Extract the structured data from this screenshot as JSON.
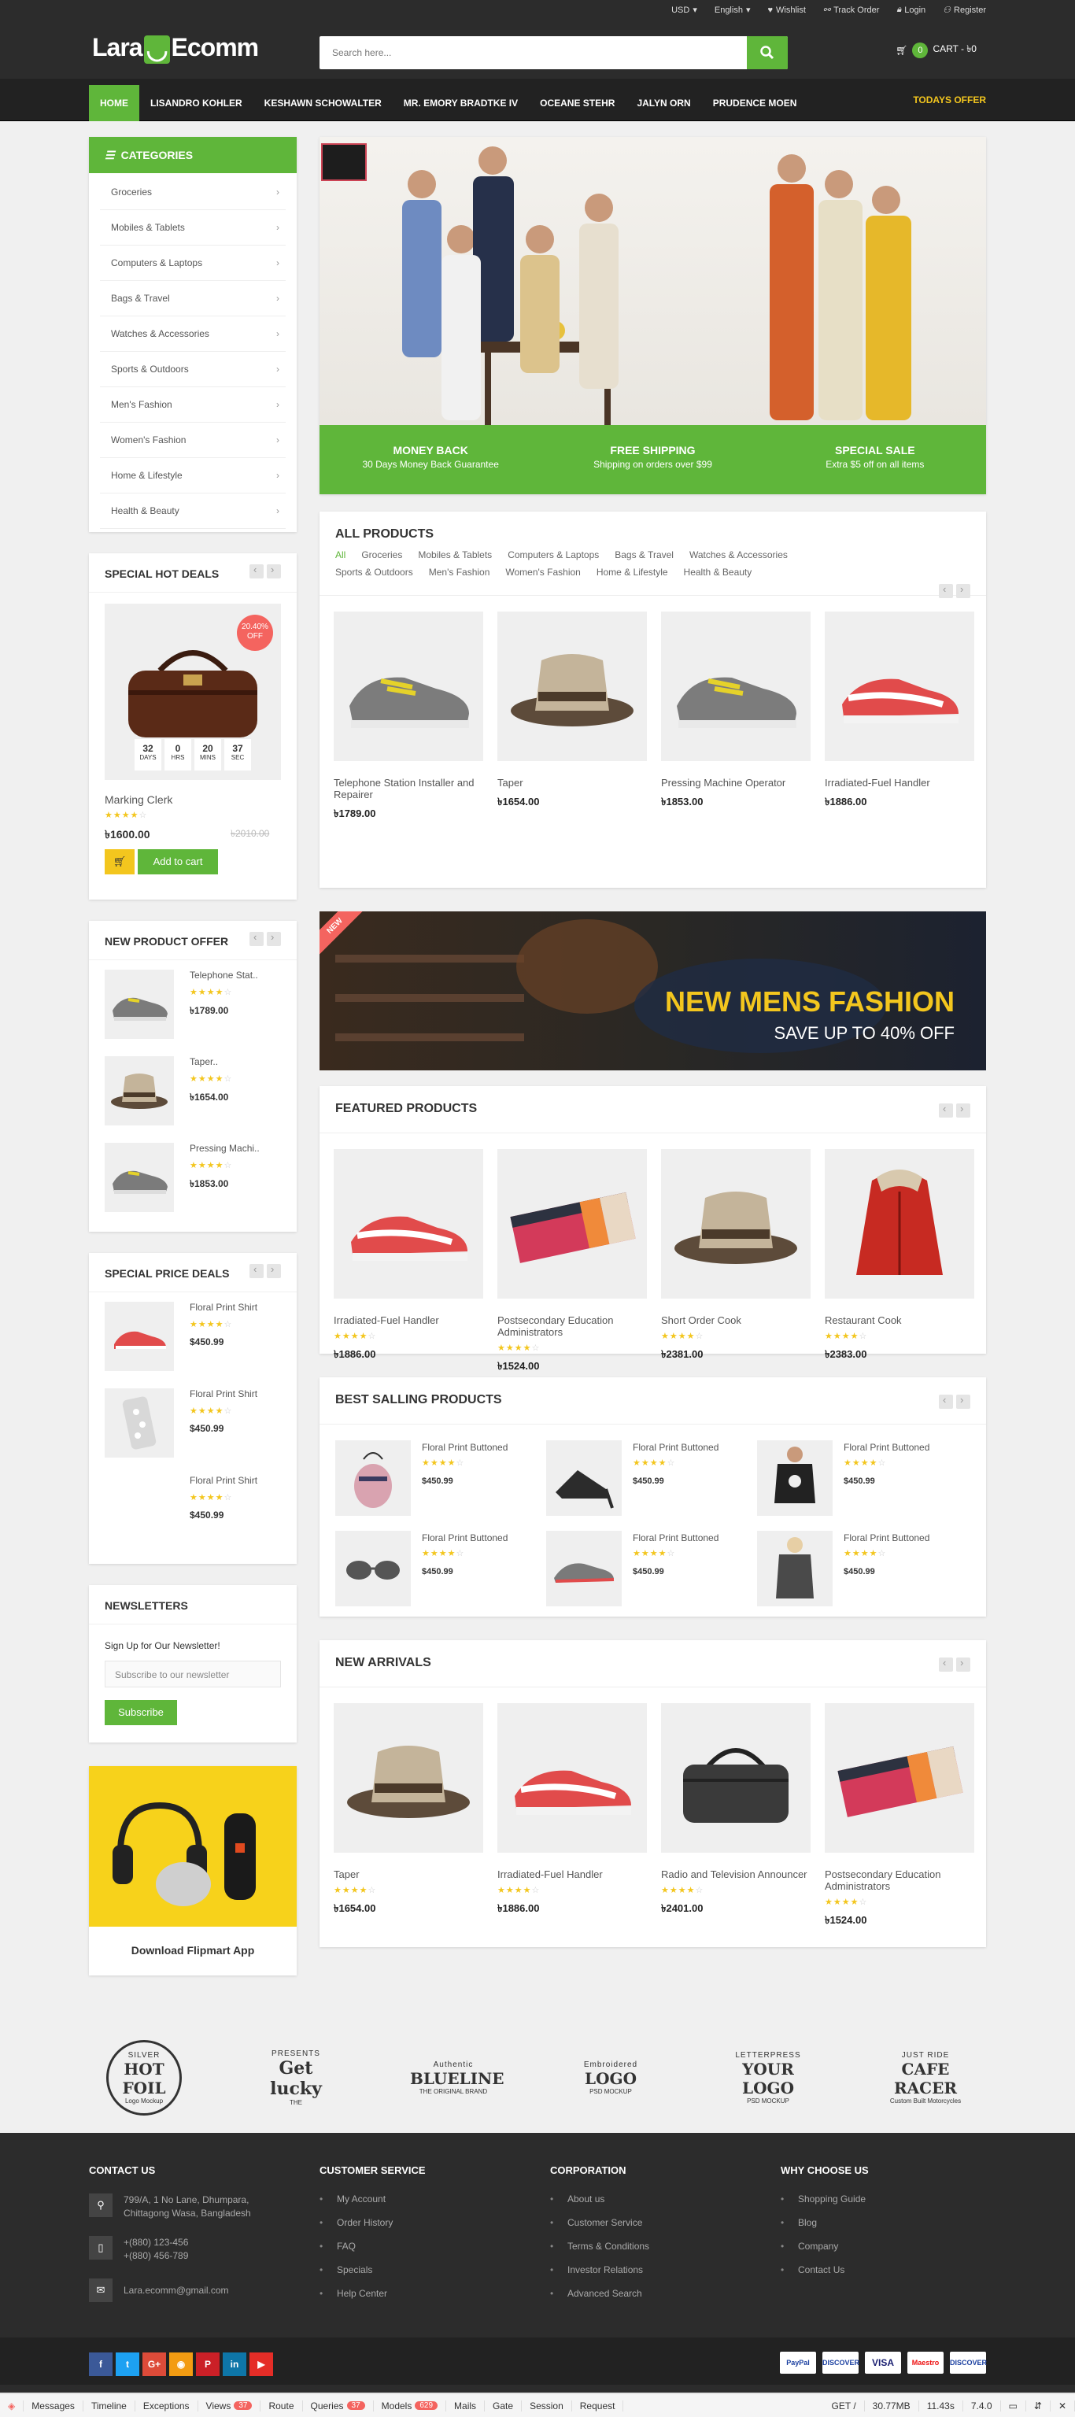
{
  "topbar": {
    "currency": "USD",
    "language": "English",
    "wishlist": "Wishlist",
    "track_order": "Track Order",
    "login": "Login",
    "register": "Register"
  },
  "logo": {
    "part1": "Lara",
    "part2": "Ecomm"
  },
  "search": {
    "placeholder": "Search here..."
  },
  "cart": {
    "count": "0",
    "label": "CART - ৳0"
  },
  "nav": {
    "items": [
      "Home",
      "Lisandro Kohler",
      "Keshawn Schowalter",
      "Mr. Emory Bradtke IV",
      "Oceane Stehr",
      "Jalyn Orn",
      "Prudence Moen"
    ],
    "offer": "Todays Offer"
  },
  "categories": {
    "title": "CATEGORIES",
    "items": [
      "Groceries",
      "Mobiles & Tablets",
      "Computers & Laptops",
      "Bags & Travel",
      "Watches & Accessories",
      "Sports & Outdoors",
      "Men's Fashion",
      "Women's Fashion",
      "Home & Lifestyle",
      "Health & Beauty"
    ]
  },
  "hot_deals": {
    "title": "SPECIAL HOT DEALS",
    "discount": "20.40%",
    "off": "OFF",
    "countdown": [
      {
        "v": "32",
        "l": "DAYS"
      },
      {
        "v": "0",
        "l": "HRS"
      },
      {
        "v": "20",
        "l": "MINS"
      },
      {
        "v": "37",
        "l": "SEC"
      }
    ],
    "name": "Marking Clerk",
    "price": "৳1600.00",
    "old_price": "৳2010.00",
    "rating": 4,
    "button": "Add to cart"
  },
  "new_offer": {
    "title": "NEW PRODUCT OFFER",
    "items": [
      {
        "name": "Telephone Stat..",
        "price": "৳1789.00"
      },
      {
        "name": "Taper..",
        "price": "৳1654.00"
      },
      {
        "name": "Pressing Machi..",
        "price": "৳1853.00"
      }
    ]
  },
  "price_deals": {
    "title": "SPECIAL PRICE DEALS",
    "items": [
      {
        "name": "Floral Print Shirt",
        "price": "$450.99"
      },
      {
        "name": "Floral Print Shirt",
        "price": "$450.99"
      },
      {
        "name": "Floral Print Shirt",
        "price": "$450.99"
      }
    ]
  },
  "newsletter": {
    "title": "NEWSLETTERS",
    "text": "Sign Up for Our Newsletter!",
    "placeholder": "Subscribe to our newsletter",
    "button": "Subscribe"
  },
  "app_banner": {
    "label": "Download Flipmart App"
  },
  "hero": {
    "features": [
      {
        "title": "MONEY BACK",
        "sub": "30 Days Money Back Guarantee"
      },
      {
        "title": "FREE SHIPPING",
        "sub": "Shipping on orders over $99"
      },
      {
        "title": "SPECIAL SALE",
        "sub": "Extra $5 off on all items"
      }
    ]
  },
  "all_products": {
    "title": "ALL PRODUCTS",
    "tabs": [
      "All",
      "Groceries",
      "Mobiles & Tablets",
      "Computers & Laptops",
      "Bags & Travel",
      "Watches & Accessories",
      "Sports & Outdoors",
      "Men's Fashion",
      "Women's Fashion",
      "Home & Lifestyle",
      "Health & Beauty"
    ],
    "items": [
      {
        "name": "Telephone Station Installer and Repairer",
        "price": "৳1789.00",
        "img": "shoe-gray"
      },
      {
        "name": "Taper",
        "price": "৳1654.00",
        "img": "hat"
      },
      {
        "name": "Pressing Machine Operator",
        "price": "৳1853.00",
        "img": "shoe-gray"
      },
      {
        "name": "Irradiated-Fuel Handler",
        "price": "৳1886.00",
        "img": "shoe-red"
      }
    ]
  },
  "promo": {
    "tag": "NEW",
    "title": "NEW MENS FASHION",
    "sub": "SAVE UP TO 40% OFF"
  },
  "featured": {
    "title": "FEATURED PRODUCTS",
    "items": [
      {
        "name": "Irradiated-Fuel Handler",
        "price": "৳1886.00",
        "img": "shoe-red"
      },
      {
        "name": "Postsecondary Education Administrators",
        "price": "৳1524.00",
        "img": "towel"
      },
      {
        "name": "Short Order Cook",
        "price": "৳2381.00",
        "img": "hat"
      },
      {
        "name": "Restaurant Cook",
        "price": "৳2383.00",
        "img": "jacket"
      }
    ]
  },
  "best_selling": {
    "title": "BEST SALLING PRODUCTS",
    "items": [
      {
        "name": "Floral Print Buttoned",
        "price": "$450.99"
      },
      {
        "name": "Floral Print Buttoned",
        "price": "$450.99"
      },
      {
        "name": "Floral Print Buttoned",
        "price": "$450.99"
      },
      {
        "name": "Floral Print Buttoned",
        "price": "$450.99"
      },
      {
        "name": "Floral Print Buttoned",
        "price": "$450.99"
      },
      {
        "name": "Floral Print Buttoned",
        "price": "$450.99"
      }
    ]
  },
  "new_arrivals": {
    "title": "NEW ARRIVALS",
    "items": [
      {
        "name": "Taper",
        "price": "৳1654.00",
        "img": "hat"
      },
      {
        "name": "Irradiated-Fuel Handler",
        "price": "৳1886.00",
        "img": "shoe-red"
      },
      {
        "name": "Radio and Television Announcer",
        "price": "৳2401.00",
        "img": "bag"
      },
      {
        "name": "Postsecondary Education Administrators",
        "price": "৳1524.00",
        "img": "towel"
      }
    ]
  },
  "brands": [
    {
      "l1": "SILVER",
      "l2": "HOT FOIL",
      "l3": "Logo Mockup"
    },
    {
      "l1": "PRESENTS",
      "l2": "Get lucky",
      "l3": "THE"
    },
    {
      "l1": "Authentic",
      "l2": "BLUELINE",
      "l3": "THE ORIGINAL BRAND"
    },
    {
      "l1": "Embroidered",
      "l2": "LOGO",
      "l3": "PSD MOCKUP"
    },
    {
      "l1": "LETTERPRESS",
      "l2": "YOUR LOGO",
      "l3": "PSD MOCKUP"
    },
    {
      "l1": "JUST RIDE",
      "l2": "CAFE RACER",
      "l3": "Custom Built Motorcycles"
    }
  ],
  "footer": {
    "contact": {
      "title": "CONTACT US",
      "address": "799/A, 1 No Lane, Dhumpara, Chittagong Wasa, Bangladesh",
      "phone1": "+(880) 123-456",
      "phone2": "+(880) 456-789",
      "email": "Lara.ecomm@gmail.com"
    },
    "service": {
      "title": "CUSTOMER SERVICE",
      "items": [
        "My Account",
        "Order History",
        "FAQ",
        "Specials",
        "Help Center"
      ]
    },
    "corporation": {
      "title": "CORPORATION",
      "items": [
        "About us",
        "Customer Service",
        "Terms & Conditions",
        "Investor Relations",
        "Advanced Search"
      ]
    },
    "why": {
      "title": "WHY CHOOSE US",
      "items": [
        "Shopping Guide",
        "Blog",
        "Company",
        "Contact Us"
      ]
    },
    "social": [
      {
        "icon": "facebook-icon",
        "g": "f",
        "c": "#3b5998"
      },
      {
        "icon": "twitter-icon",
        "g": "t",
        "c": "#1da1f2"
      },
      {
        "icon": "google-plus-icon",
        "g": "G+",
        "c": "#dd4b39"
      },
      {
        "icon": "rss-icon",
        "g": "◉",
        "c": "#f39c12"
      },
      {
        "icon": "pinterest-icon",
        "g": "P",
        "c": "#cb2027"
      },
      {
        "icon": "linkedin-icon",
        "g": "in",
        "c": "#0e76a8"
      },
      {
        "icon": "youtube-icon",
        "g": "▶",
        "c": "#e52d27"
      }
    ],
    "payments": [
      "PayPal",
      "DISCOVER",
      "VISA",
      "Maestro",
      "DISCOVER"
    ]
  },
  "debugbar": {
    "items": [
      "Messages",
      "Timeline",
      "Exceptions",
      "Views",
      "Route",
      "Queries",
      "Models",
      "Mails",
      "Gate",
      "Session",
      "Request"
    ],
    "views_count": "37",
    "queries_count": "37",
    "models_count": "629",
    "right": [
      "GET /",
      "30.77MB",
      "11.43s",
      "7.4.0"
    ]
  },
  "colors": {
    "accent": "#5fb63a",
    "dark": "#2c2c2c",
    "star": "#f3c61e",
    "offer": "#f3c61e"
  }
}
